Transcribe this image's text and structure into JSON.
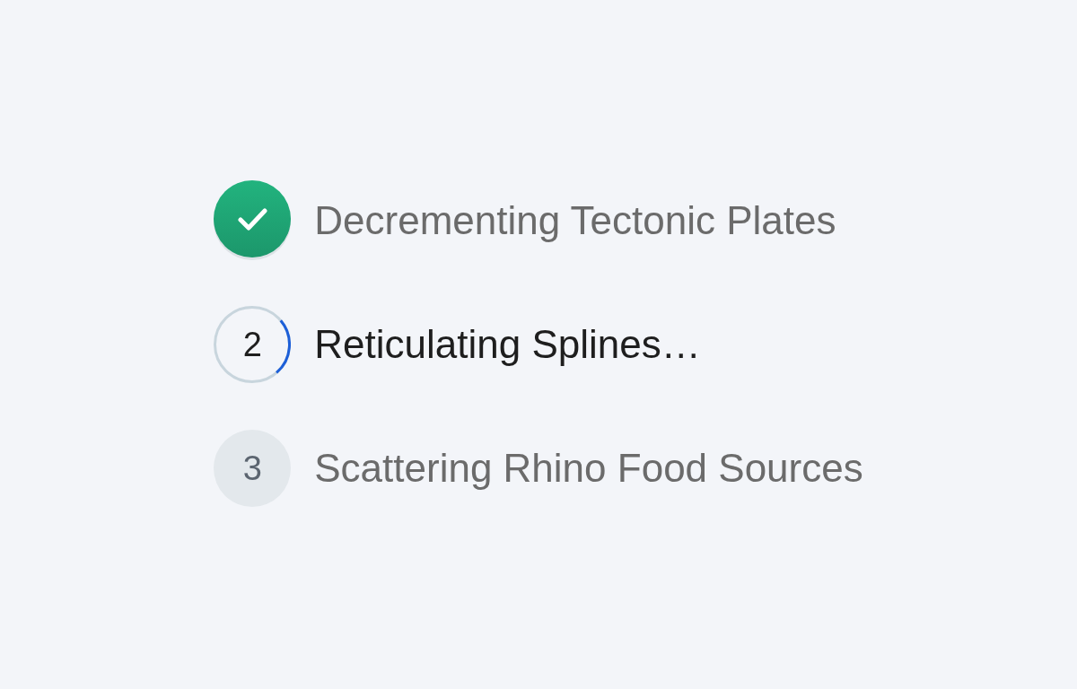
{
  "steps": [
    {
      "kind": "done",
      "label": "Decrementing Tectonic Plates"
    },
    {
      "kind": "active",
      "number": "2",
      "label": "Reticulating Splines…"
    },
    {
      "kind": "pending",
      "number": "3",
      "label": "Scattering Rhino Food Sources"
    }
  ]
}
